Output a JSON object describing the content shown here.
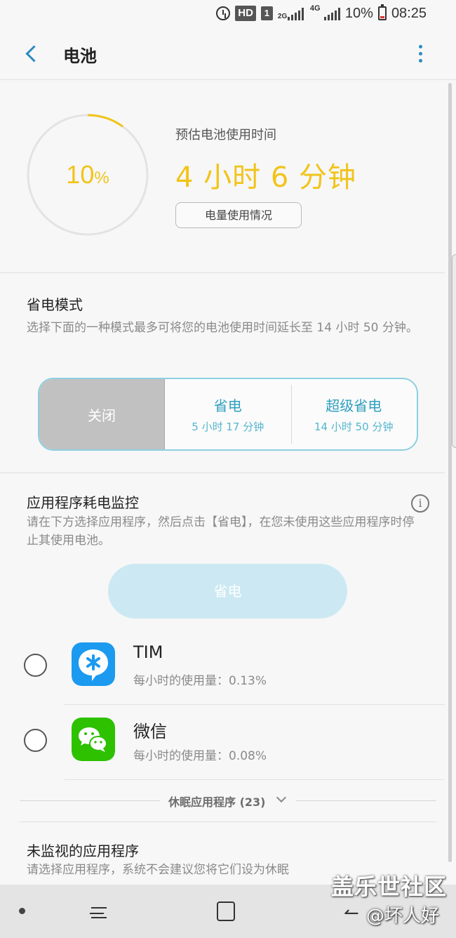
{
  "status_bar": {
    "hd": "HD",
    "sim": "1",
    "net_2g": "2G",
    "net_4g": "4G",
    "battery_pct": "10%",
    "time": "08:25"
  },
  "header": {
    "title": "电池"
  },
  "battery": {
    "level_pct": "10",
    "level_unit": "%",
    "level_fraction": 0.1,
    "estimate_label": "预估电池使用时间",
    "estimate_value": "4 小时 6 分钟",
    "usage_button": "电量使用情况",
    "accent": "#f1c41b"
  },
  "power_mode": {
    "title": "省电模式",
    "description": "选择下面的一种模式最多可将您的电池使用时间延长至 14 小时 50 分钟。",
    "options": [
      {
        "label": "关闭",
        "time": ""
      },
      {
        "label": "省电",
        "time": "5 小时 17 分钟"
      },
      {
        "label": "超级省电",
        "time": "14 小时 50 分钟"
      }
    ],
    "selected": "关闭"
  },
  "app_monitor": {
    "title": "应用程序耗电监控",
    "description": "请在下方选择应用程序，然后点击【省电】，在您未使用这些应用程序时停止其使用电池。",
    "save_button": "省电",
    "apps": [
      {
        "name": "TIM",
        "usage": "每小时的使用量：0.13%",
        "icon": "tim-icon"
      },
      {
        "name": "微信",
        "usage": "每小时的使用量：0.08%",
        "icon": "wechat-icon"
      }
    ],
    "sleeping_label": "休眠应用程序 (23)"
  },
  "unmonitored": {
    "title": "未监视的应用程序",
    "description": "请选择应用程序，系统不会建议您将它们设为休眠"
  },
  "watermark": {
    "site": "盖乐世社区",
    "user": "@坏人好"
  }
}
